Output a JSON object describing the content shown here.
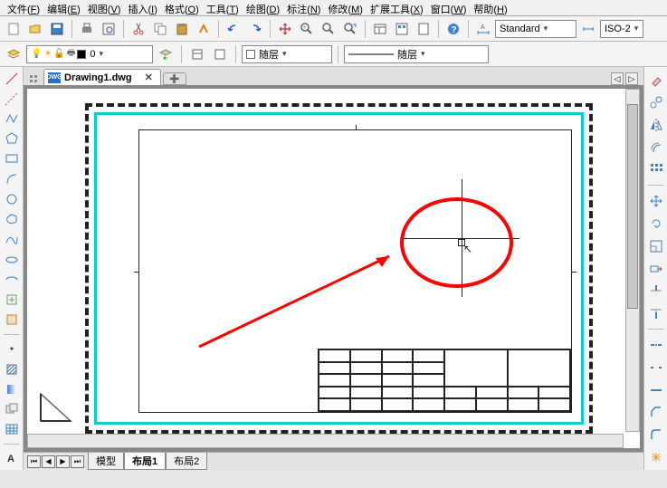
{
  "menu": {
    "items": [
      {
        "label": "文件",
        "key": "F"
      },
      {
        "label": "编辑",
        "key": "E"
      },
      {
        "label": "视图",
        "key": "V"
      },
      {
        "label": "插入",
        "key": "I"
      },
      {
        "label": "格式",
        "key": "O"
      },
      {
        "label": "工具",
        "key": "T"
      },
      {
        "label": "绘图",
        "key": "D"
      },
      {
        "label": "标注",
        "key": "N"
      },
      {
        "label": "修改",
        "key": "M"
      },
      {
        "label": "扩展工具",
        "key": "X"
      },
      {
        "label": "窗口",
        "key": "W"
      },
      {
        "label": "帮助",
        "key": "H"
      }
    ]
  },
  "toolbar": {
    "style_label": "Standard",
    "iso_label": "ISO-2"
  },
  "properties": {
    "layer_value": "0",
    "color_label": "随层",
    "linetype_label": "随层"
  },
  "doc": {
    "filename": "Drawing1.dwg"
  },
  "layout_tabs": {
    "model": "模型",
    "layout1": "布局1",
    "layout2": "布局2"
  },
  "icons": {
    "light_on": "💡",
    "sun": "☀",
    "lock": "🔓",
    "printer": "🖶",
    "square": "■"
  }
}
